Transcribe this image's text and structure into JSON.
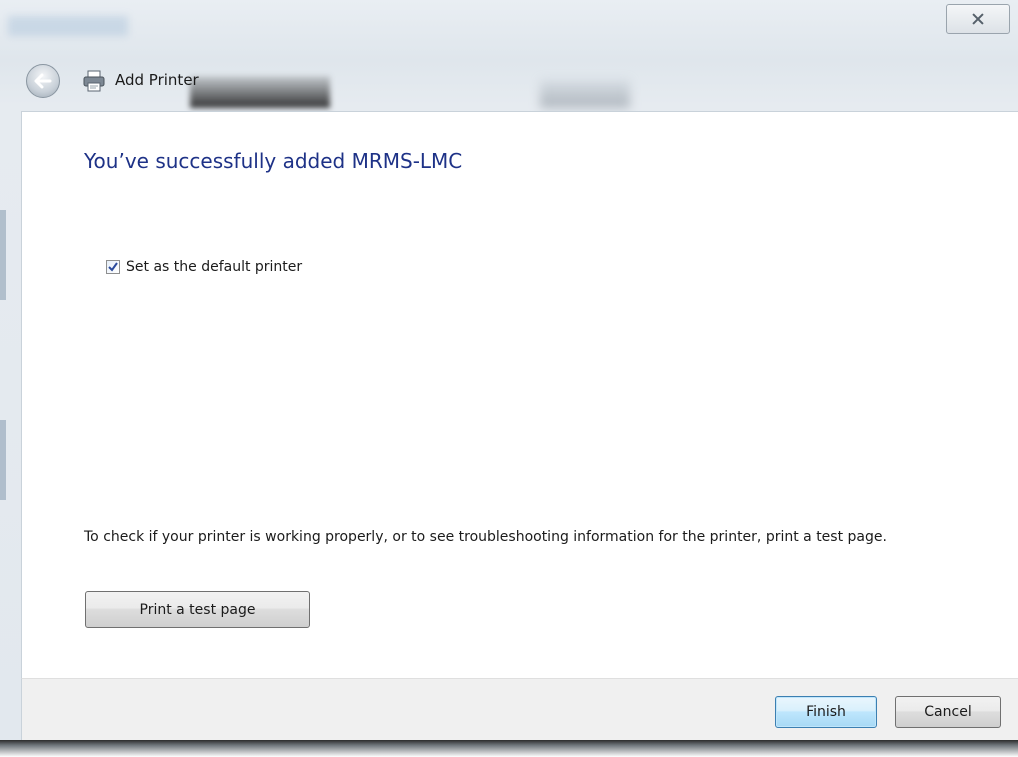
{
  "window": {
    "title": "Add Printer"
  },
  "content": {
    "heading": "You’ve successfully added MRMS-LMC",
    "default_printer": {
      "label": "Set as the default printer",
      "checked": true
    },
    "info_text": "To check if your printer is working properly, or to see troubleshooting information for the printer, print a test page.",
    "test_page_button": "Print a test page"
  },
  "footer": {
    "finish_label": "Finish",
    "cancel_label": "Cancel"
  },
  "colors": {
    "heading": "#1e3287",
    "finish_border": "#3c7fb1",
    "frame": "#e2e8ee"
  },
  "icons": {
    "close": "close-icon",
    "back": "back-arrow-icon",
    "printer": "printer-icon",
    "check": "check-icon"
  }
}
